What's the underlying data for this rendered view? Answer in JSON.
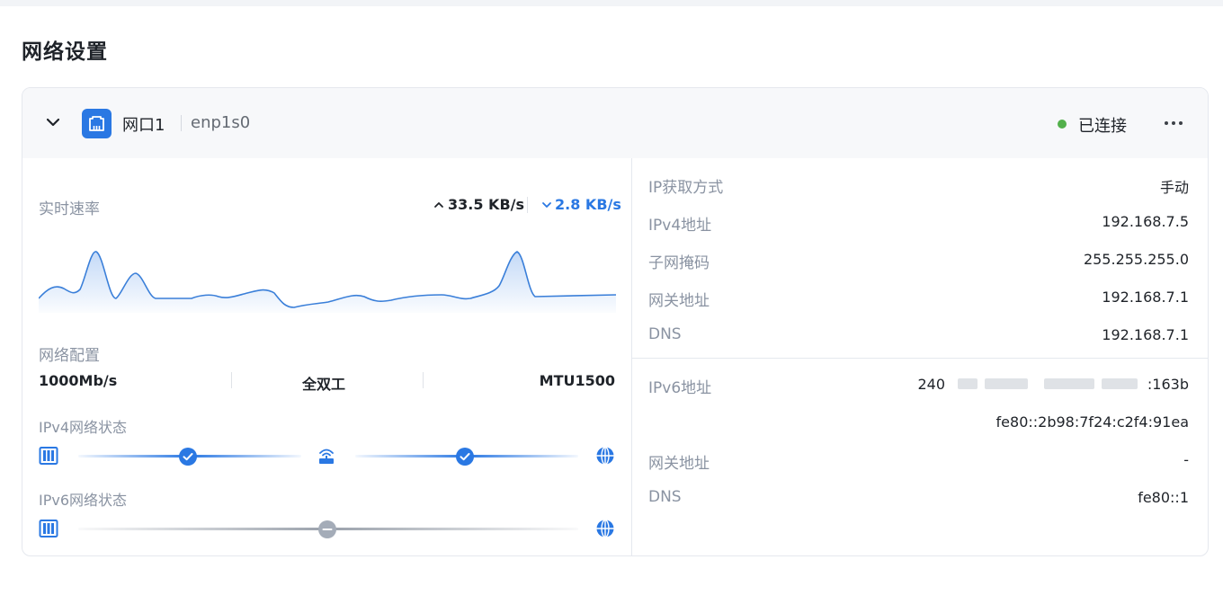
{
  "page": {
    "title": "网络设置"
  },
  "colors": {
    "accent": "#2a78e3",
    "status_ok": "#52b04b",
    "muted": "#8a93a2",
    "disabled": "#a4acb8"
  },
  "interface": {
    "name": "网口1",
    "device": "enp1s0",
    "status": "已连接",
    "icons": {
      "collapse": "chevron-down-icon",
      "port": "ethernet-port-icon",
      "more": "more-horizontal-icon"
    }
  },
  "speed": {
    "label": "实时速率",
    "upload": "33.5 KB/s",
    "download": "2.8 KB/s",
    "upload_icon": "arrow-up-icon",
    "download_icon": "arrow-down-icon"
  },
  "network_config": {
    "label": "网络配置",
    "link_speed": "1000Mb/s",
    "duplex": "全双工",
    "mtu": "MTU1500"
  },
  "ipv4_status": {
    "label": "IPv4网络状态",
    "nodes": [
      "port-icon",
      "router-icon",
      "globe-icon"
    ],
    "links": [
      "connected",
      "connected"
    ]
  },
  "ipv6_status": {
    "label": "IPv6网络状态",
    "nodes": [
      "port-icon",
      "globe-icon"
    ],
    "links": [
      "inactive"
    ]
  },
  "ipv4_details": [
    {
      "label": "IP获取方式",
      "value": "手动"
    },
    {
      "label": "IPv4地址",
      "value": "192.168.7.5"
    },
    {
      "label": "子网掩码",
      "value": "255.255.255.0"
    },
    {
      "label": "网关地址",
      "value": "192.168.7.1"
    },
    {
      "label": "DNS",
      "value": "192.168.7.1"
    }
  ],
  "ipv6_details": {
    "address_label": "IPv6地址",
    "address_prefix": "240",
    "address_suffix": ":163b",
    "link_local": "fe80::2b98:7f24:c2f4:91ea",
    "gateway_label": "网关地址",
    "gateway_value": "-",
    "dns_label": "DNS",
    "dns_value": "fe80::1"
  }
}
